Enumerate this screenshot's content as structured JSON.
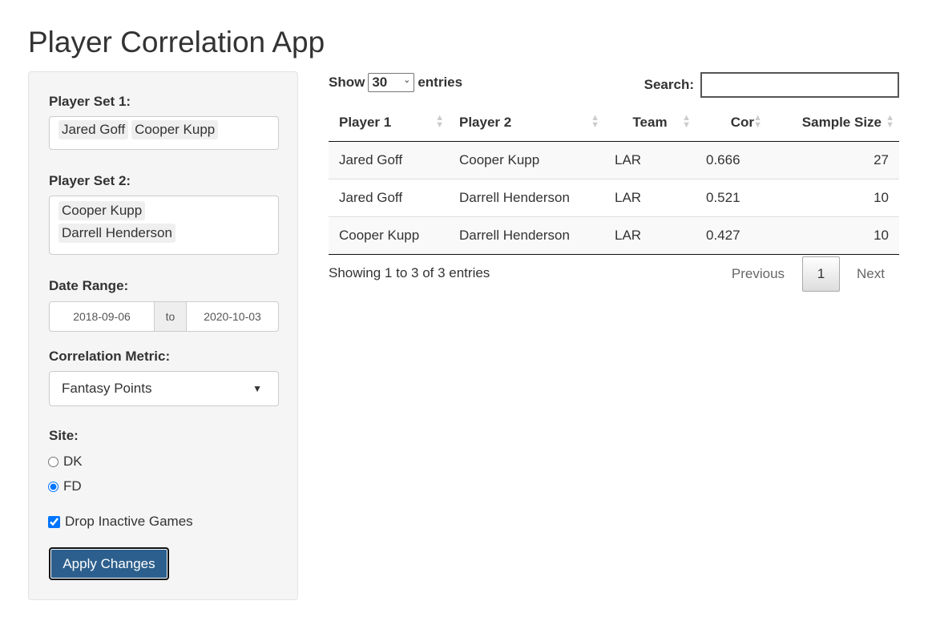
{
  "title": "Player Correlation App",
  "sidebar": {
    "player_set_1": {
      "label": "Player Set 1:",
      "values": [
        "Jared Goff",
        "Cooper Kupp"
      ]
    },
    "player_set_2": {
      "label": "Player Set 2:",
      "values": [
        "Cooper Kupp",
        "Darrell Henderson"
      ]
    },
    "date_range": {
      "label": "Date Range:",
      "start": "2018-09-06",
      "sep": "to",
      "end": "2020-10-03"
    },
    "metric": {
      "label": "Correlation Metric:",
      "value": "Fantasy Points"
    },
    "site": {
      "label": "Site:",
      "options": [
        "DK",
        "FD"
      ],
      "selected": "FD"
    },
    "drop_inactive": {
      "label": "Drop Inactive Games",
      "checked": true
    },
    "apply": "Apply Changes"
  },
  "table": {
    "show": "Show",
    "length": "30",
    "entries": "entries",
    "search_label": "Search:",
    "search_value": "",
    "columns": [
      "Player 1",
      "Player 2",
      "Team",
      "Cor",
      "Sample Size"
    ],
    "rows": [
      [
        "Jared Goff",
        "Cooper Kupp",
        "LAR",
        "0.666",
        "27"
      ],
      [
        "Jared Goff",
        "Darrell Henderson",
        "LAR",
        "0.521",
        "10"
      ],
      [
        "Cooper Kupp",
        "Darrell Henderson",
        "LAR",
        "0.427",
        "10"
      ]
    ],
    "info": "Showing 1 to 3 of 3 entries",
    "prev": "Previous",
    "page": "1",
    "next": "Next"
  },
  "colors": {
    "button": "#2c5f8d",
    "accent": "#0d6efd"
  }
}
